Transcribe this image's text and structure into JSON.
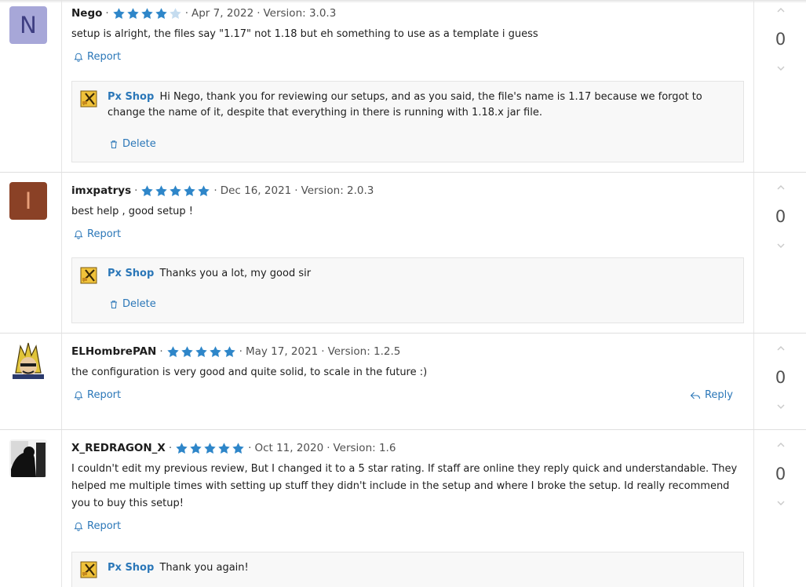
{
  "reviews": [
    {
      "author": "Nego",
      "avatar_letter": "N",
      "rating": 4,
      "date": "Apr 7, 2022",
      "version": "Version: 3.0.3",
      "text": "setup is alright, the files say \"1.17\" not 1.18 but eh something to use as a template i guess",
      "report_label": "Report",
      "vote_count": "0",
      "reply": {
        "author": "Px Shop",
        "text": "Hi Nego, thank you for reviewing our setups, and as you said, the file's name is 1.17 because we forgot to change the name of it, despite that everything in there is running with 1.18.x jar file.",
        "delete_label": "Delete"
      }
    },
    {
      "author": "imxpatrys",
      "avatar_letter": "I",
      "rating": 5,
      "date": "Dec 16, 2021",
      "version": "Version: 2.0.3",
      "text": "best help , good setup !",
      "report_label": "Report",
      "vote_count": "0",
      "reply": {
        "author": "Px Shop",
        "text": "Thanks you a lot, my good sir",
        "delete_label": "Delete"
      }
    },
    {
      "author": "ELHombrePAN",
      "rating": 5,
      "date": "May 17, 2021",
      "version": "Version: 1.2.5",
      "text": "the configuration is very good and quite solid, to scale in the future :)",
      "report_label": "Report",
      "reply_label": "Reply",
      "vote_count": "0"
    },
    {
      "author": "X_REDRAGON_X",
      "rating": 5,
      "date": "Oct 11, 2020",
      "version": "Version: 1.6",
      "text": "I couldn't edit my previous review, But I changed it to a 5 star rating. If staff are online they reply quick and understandable. They helped me multiple times with setting up stuff they didn't include in the setup and where I broke the setup. Id really recommend you to buy this setup!",
      "report_label": "Report",
      "vote_count": "0",
      "reply": {
        "author": "Px Shop",
        "text": "Thank you again!"
      }
    }
  ],
  "colors": {
    "star_filled": "#2e86c9",
    "star_empty": "#c5dcef",
    "link": "#2b77b8"
  }
}
